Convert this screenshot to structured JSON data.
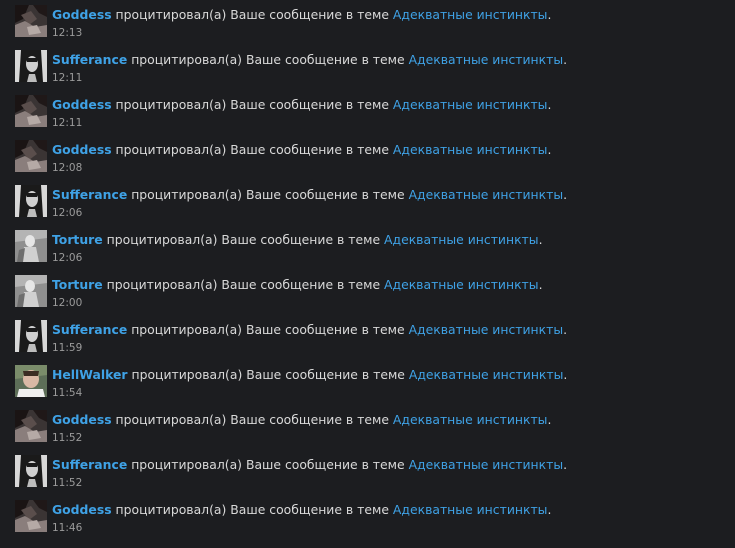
{
  "alerts": [
    {
      "user": "Goddess",
      "avatar": "goddess",
      "action": "процитировал(а) Ваше сообщение в теме",
      "thread": "Адекватные инстинкты",
      "end": ".",
      "time": "12:13"
    },
    {
      "user": "Sufferance",
      "avatar": "sufferance",
      "action": "процитировал(а) Ваше сообщение в теме",
      "thread": "Адекватные инстинкты",
      "end": ".",
      "time": "12:11"
    },
    {
      "user": "Goddess",
      "avatar": "goddess",
      "action": "процитировал(а) Ваше сообщение в теме",
      "thread": "Адекватные инстинкты",
      "end": ".",
      "time": "12:11"
    },
    {
      "user": "Goddess",
      "avatar": "goddess",
      "action": "процитировал(а) Ваше сообщение в теме",
      "thread": "Адекватные инстинкты",
      "end": ".",
      "time": "12:08"
    },
    {
      "user": "Sufferance",
      "avatar": "sufferance",
      "action": "процитировал(а) Ваше сообщение в теме",
      "thread": "Адекватные инстинкты",
      "end": ".",
      "time": "12:06"
    },
    {
      "user": "Torture",
      "avatar": "torture",
      "action": "процитировал(а) Ваше сообщение в теме",
      "thread": "Адекватные инстинкты",
      "end": ".",
      "time": "12:06"
    },
    {
      "user": "Torture",
      "avatar": "torture",
      "action": "процитировал(а) Ваше сообщение в теме",
      "thread": "Адекватные инстинкты",
      "end": ".",
      "time": "12:00"
    },
    {
      "user": "Sufferance",
      "avatar": "sufferance",
      "action": "процитировал(а) Ваше сообщение в теме",
      "thread": "Адекватные инстинкты",
      "end": ".",
      "time": "11:59"
    },
    {
      "user": "HellWalker",
      "avatar": "hellwalker",
      "action": "процитировал(а) Ваше сообщение в теме",
      "thread": "Адекватные инстинкты",
      "end": ".",
      "time": "11:54"
    },
    {
      "user": "Goddess",
      "avatar": "goddess",
      "action": "процитировал(а) Ваше сообщение в теме",
      "thread": "Адекватные инстинкты",
      "end": ".",
      "time": "11:52"
    },
    {
      "user": "Sufferance",
      "avatar": "sufferance",
      "action": "процитировал(а) Ваше сообщение в теме",
      "thread": "Адекватные инстинкты",
      "end": ".",
      "time": "11:52"
    },
    {
      "user": "Goddess",
      "avatar": "goddess",
      "action": "процитировал(а) Ваше сообщение в теме",
      "thread": "Адекватные инстинкты",
      "end": ".",
      "time": "11:46"
    }
  ],
  "colors": {
    "background": "#1c1d20",
    "link": "#3fa2e6",
    "text": "#d9d9d9",
    "time": "#9b9b9b"
  }
}
